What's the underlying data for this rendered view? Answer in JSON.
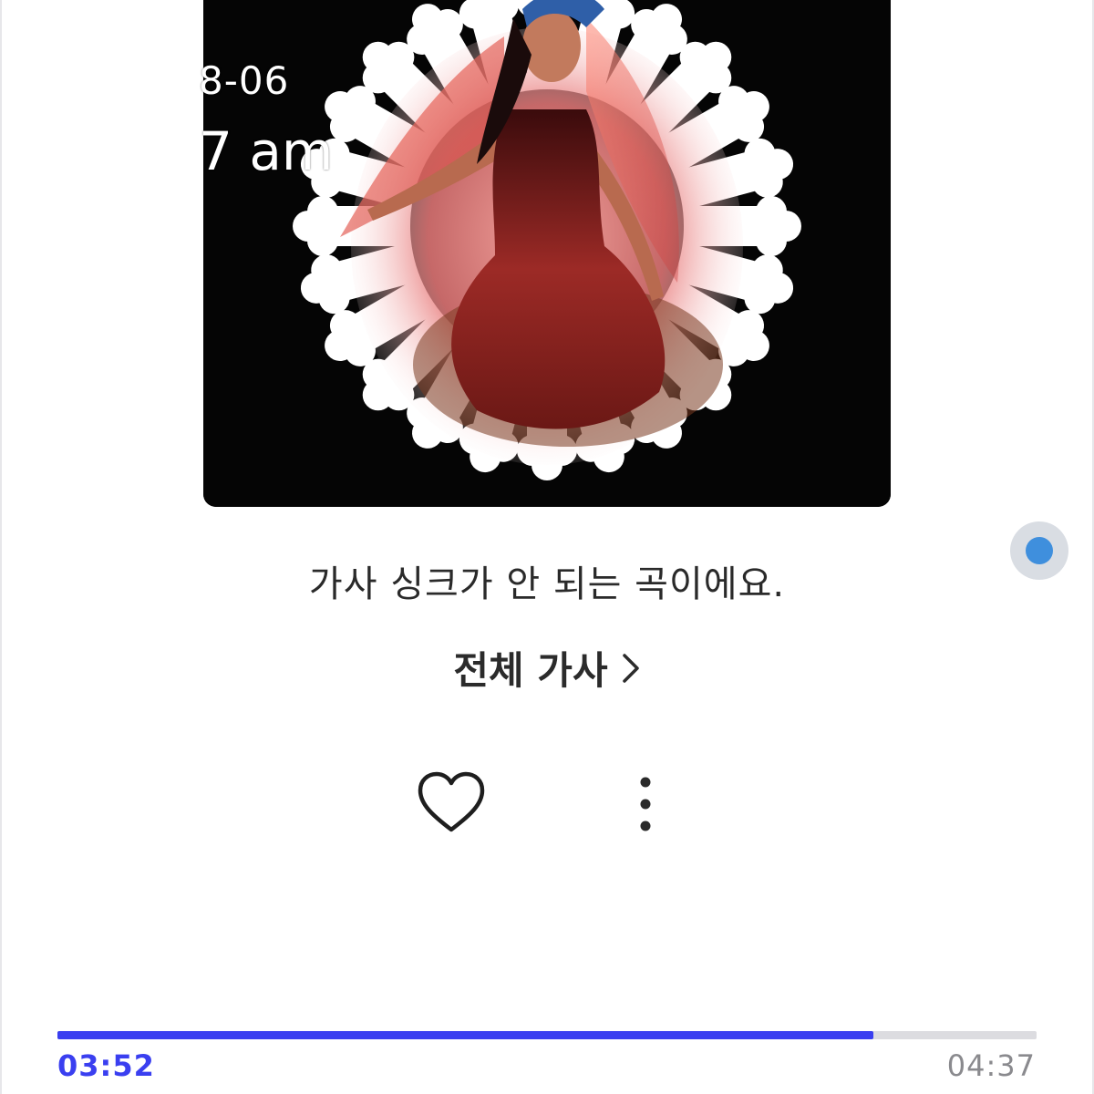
{
  "overlay": {
    "date": "8-06",
    "time": "7 am"
  },
  "album": {
    "art_icon": "album-cover-art"
  },
  "lyrics": {
    "notice": "가사 싱크가 안 되는 곡이에요.",
    "full_lyrics_label": "전체 가사"
  },
  "actions": {
    "like_icon": "heart-icon",
    "more_icon": "more-vertical-icon"
  },
  "player": {
    "elapsed": "03:52",
    "total": "04:37",
    "progress_fraction": 0.833
  },
  "colors": {
    "accent": "#3a3ff0",
    "track": "#dcdce0",
    "float_dot": "#3f8fdd"
  }
}
